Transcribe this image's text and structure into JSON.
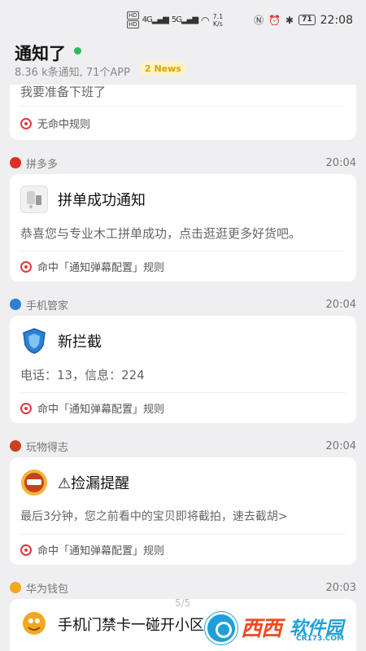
{
  "status_bar": {
    "hd1": "HD",
    "hd2": "HD",
    "sig1": "4G",
    "sig2": "5G",
    "speed_value": "7.1",
    "speed_unit": "K/s",
    "battery": "71",
    "time": "22:08"
  },
  "header": {
    "title": "通知了",
    "subtitle": "8.36 k条通知, 71个APP",
    "news_badge": "2 News"
  },
  "cards": [
    {
      "message": "我要准备下班了",
      "rule": "无命中规则"
    },
    {
      "app": "拼多多",
      "time": "20:04",
      "title": "拼单成功通知",
      "message": "恭喜您与专业木工拼单成功，点击逛逛更多好货吧。",
      "rule": "命中「通知弹幕配置」规则",
      "icon_color": "#e02e24",
      "app_icon": "pinduoduo-icon"
    },
    {
      "app": "手机管家",
      "time": "20:04",
      "title": "新拦截",
      "message": "电话：13，信息：224",
      "rule": "命中「通知弹幕配置」规则",
      "icon_color": "#2f7fd6",
      "app_icon": "shield-icon"
    },
    {
      "app": "玩物得志",
      "time": "20:04",
      "title": "⚠捡漏提醒",
      "message": "最后3分钟，您之前看中的宝贝即将截拍，速去截胡>",
      "rule": "命中「通知弹幕配置」规则",
      "icon_color": "#c8401e",
      "app_icon": "wanwudezhi-icon"
    },
    {
      "app": "华为钱包",
      "time": "20:03",
      "title": "手机门禁卡一碰开小区",
      "icon_color": "#f1a81f",
      "app_icon": "wallet-icon"
    }
  ],
  "page_indicator": "5/5",
  "watermark": {
    "text1": "西西",
    "text2": "软件园",
    "text3": "CR173.COM"
  },
  "colors": {
    "online_dot": "#2bbd55",
    "news_badge": "#d9a400",
    "rule_target": "#e0393e",
    "background": "#efeff1"
  }
}
